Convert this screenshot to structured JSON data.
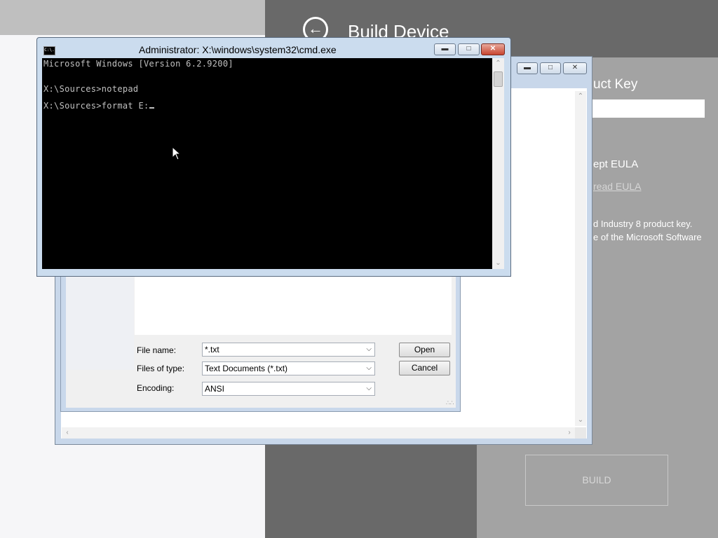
{
  "background_app": {
    "page_title": "Build Device",
    "product_key_label": "uct Key",
    "product_key_value": "",
    "eula_label": "ept EULA",
    "eula_link": "read EULA",
    "description_line1": "d Industry 8 product key.",
    "description_line2": "e of the Microsoft Software",
    "build_button": "BUILD"
  },
  "notepad_window": {
    "open_dialog": {
      "file_name_label": "File name:",
      "file_name_value": "*.txt",
      "files_of_type_label": "Files of type:",
      "files_of_type_value": "Text Documents (*.txt)",
      "encoding_label": "Encoding:",
      "encoding_value": "ANSI",
      "open_button": "Open",
      "cancel_button": "Cancel"
    }
  },
  "cmd_window": {
    "title": "Administrator: X:\\windows\\system32\\cmd.exe",
    "icon_text": "C:\\.",
    "lines": [
      "Microsoft Windows [Version 6.2.9200]",
      "X:\\Sources>notepad",
      "X:\\Sources>format E:"
    ]
  },
  "colors": {
    "console_bg": "#000000",
    "console_text": "#c0c0c0",
    "background_gray": "#696969",
    "panel_gray": "#a3a3a3"
  }
}
